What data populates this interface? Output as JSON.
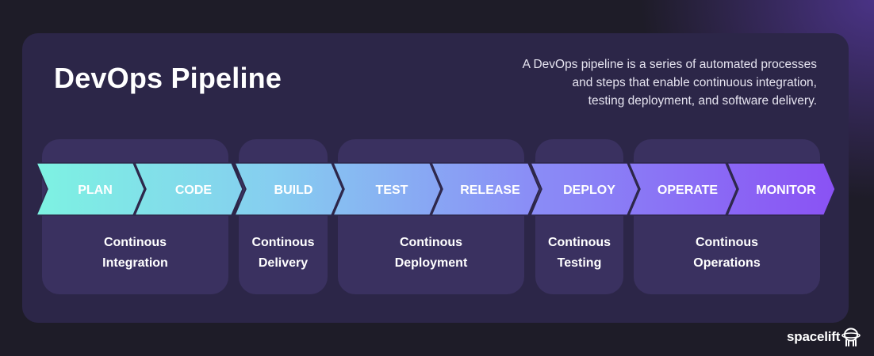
{
  "header": {
    "title": "DevOps Pipeline",
    "description": [
      "A DevOps pipeline is a series of automated processes",
      "and steps that enable continuous integration,",
      "testing deployment, and software delivery."
    ]
  },
  "stages": [
    {
      "label": "PLAN",
      "color": "#7df0e4"
    },
    {
      "label": "CODE",
      "color": "#82e4ea"
    },
    {
      "label": "BUILD",
      "color": "#86ccf0"
    },
    {
      "label": "TEST",
      "color": "#88b6f2"
    },
    {
      "label": "RELEASE",
      "color": "#8a9ef4"
    },
    {
      "label": "DEPLOY",
      "color": "#8a88f6"
    },
    {
      "label": "OPERATE",
      "color": "#8a6ef6"
    },
    {
      "label": "MONITOR",
      "color": "#8a56f4"
    }
  ],
  "groups": [
    {
      "line1": "Continous",
      "line2": "Integration"
    },
    {
      "line1": "Continous",
      "line2": "Delivery"
    },
    {
      "line1": "Continous",
      "line2": "Deployment"
    },
    {
      "line1": "Continous",
      "line2": "Testing"
    },
    {
      "line1": "Continous",
      "line2": "Operations"
    }
  ],
  "brand": {
    "name": "spacelift",
    "logo_icon": "astronaut-icon"
  }
}
